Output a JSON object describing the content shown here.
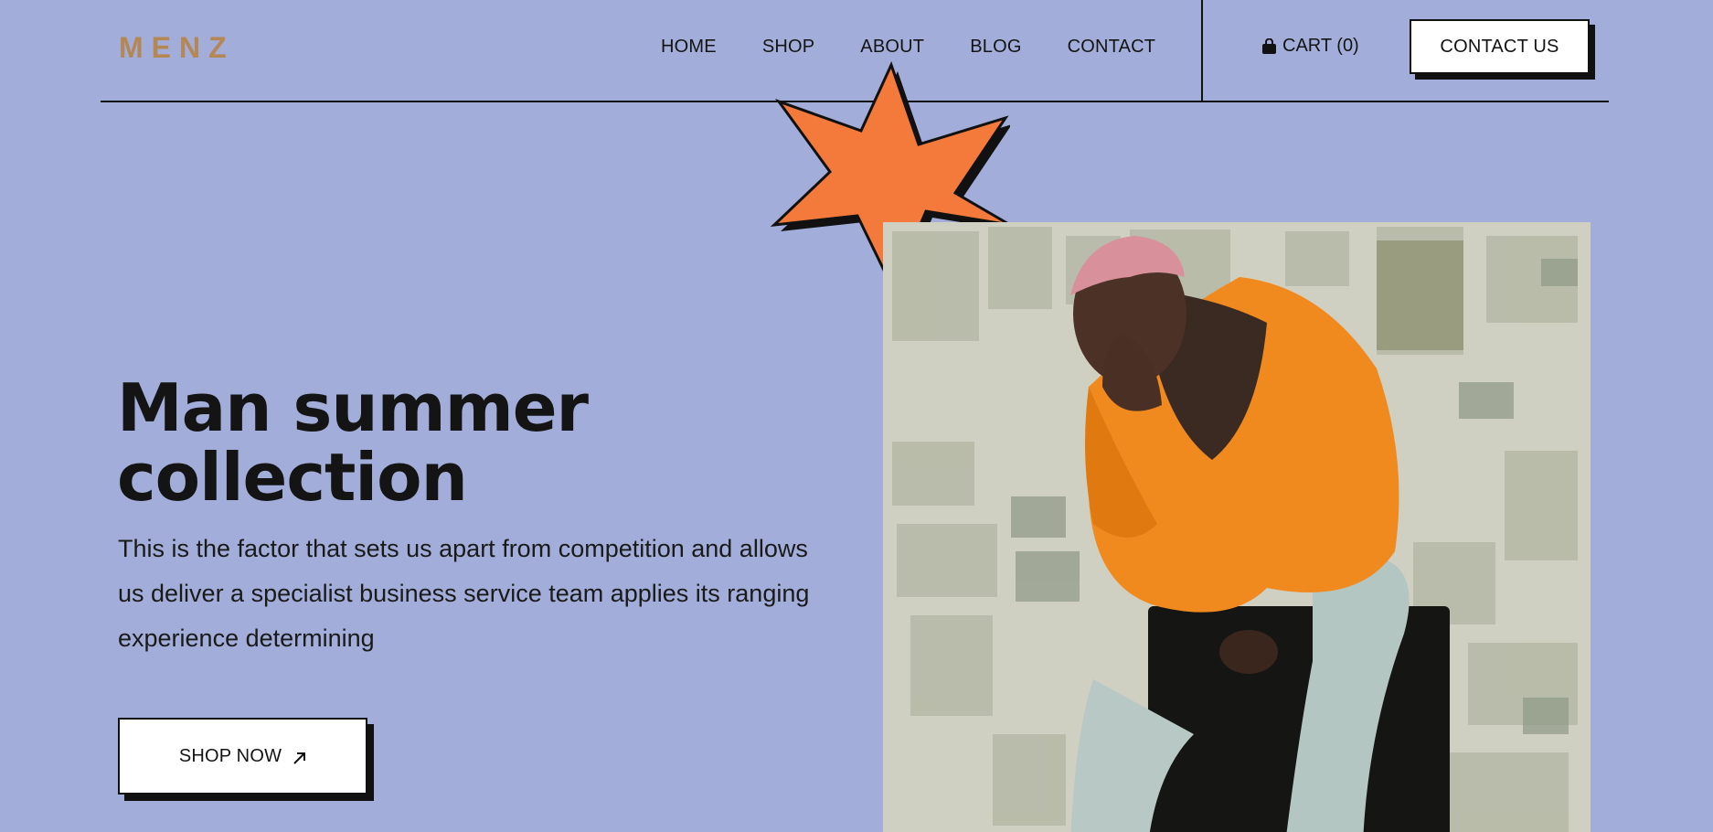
{
  "brand": {
    "logo": "MENZ",
    "color": "#B58755"
  },
  "nav": {
    "items": [
      {
        "label": "HOME"
      },
      {
        "label": "SHOP"
      },
      {
        "label": "ABOUT"
      },
      {
        "label": "BLOG"
      },
      {
        "label": "CONTACT"
      }
    ]
  },
  "header": {
    "cart_label": "CART (0)",
    "cart_icon": "shopping-bag-icon",
    "contact_label": "CONTACT US"
  },
  "hero": {
    "title_line1": "Man summer",
    "title_line2": "collection",
    "description": "This is the factor that sets us apart from competition and allows us deliver a specialist business service team applies its ranging experience determining",
    "cta_label": "SHOP NOW",
    "cta_icon": "arrow-up-right-icon"
  },
  "colors": {
    "background": "#A2AED9",
    "accent_star": "#F47A3C",
    "ink": "#141414"
  }
}
